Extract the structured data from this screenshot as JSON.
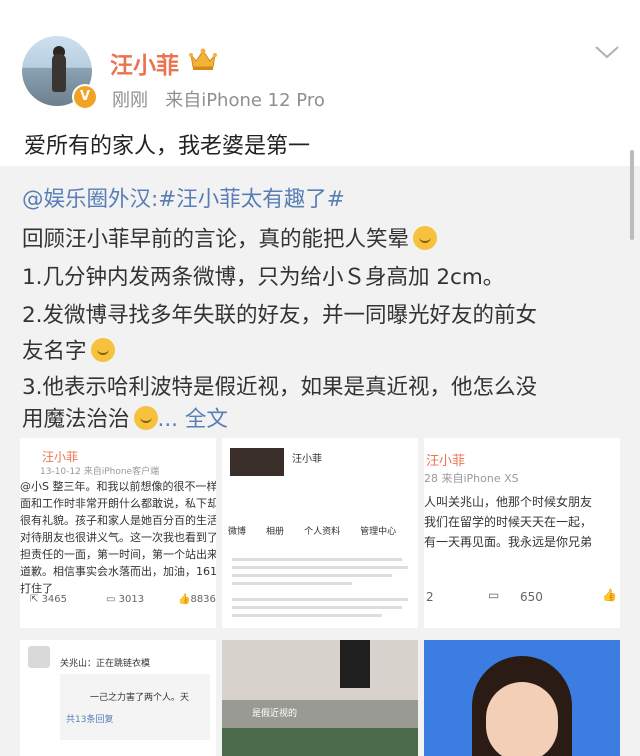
{
  "post": {
    "username": "汪小菲",
    "time": "刚刚",
    "source": "来自iPhone 12 Pro",
    "text": "爱所有的家人，我老婆是第一",
    "verified_badge": "V"
  },
  "repost": {
    "lines": [
      {
        "link": "@娱乐圈外汉:#汪小菲太有趣了#",
        "text": ""
      },
      {
        "link": "",
        "text": "回顾汪小菲早前的言论，真的能把人笑晕"
      },
      {
        "link": "",
        "text": "1.几分钟内发两条微博，只为给小Ｓ身高加 2cm。"
      },
      {
        "link": "",
        "text": "2.发微博寻找多年失联的好友，并一同曝光好友的前女"
      },
      {
        "link": "",
        "text": "友名字"
      },
      {
        "link": "",
        "text": "3.他表示哈利波特是假近视，如果是真近视，他怎么没"
      },
      {
        "link": "",
        "text": "用魔法治治"
      }
    ],
    "more": "... 全文",
    "images": {
      "img1": {
        "name": "汪小菲",
        "meta": "13-10-12 来自iPhone客户端",
        "body": [
          "@小S 整三年。和我以前想像的很不一样：",
          "面和工作时非常开朗什么都敢说，私下却",
          "很有礼貌。孩子和家人是她百分百的生活",
          "对待朋友也很讲义气。这一次我也看到了",
          "担责任的一面，第一时间，第一个站出来",
          "道歉。相信事实会水落而出，加油，161",
          "打住了"
        ],
        "reposts": "3465",
        "comments": "3013",
        "likes": "8836"
      },
      "img2": {
        "name": "汪小菲",
        "tabs": [
          "微博",
          "相册",
          "个人资料",
          "管理中心"
        ]
      },
      "img3": {
        "name": "汪小菲",
        "meta": "28 来自iPhone XS",
        "body": [
          "人叫关兆山，他那个时候女朋友",
          "我们在留学的时候天天在一起，",
          "有一天再见面。我永远是你兄弟"
        ],
        "reposts": "2",
        "likes_label": "650"
      },
      "img4": {
        "line1": "关兆山：正在跳链衣模",
        "line2": "一己之力害了两个人。天",
        "line3": "共13条回复"
      },
      "img5": {
        "caption": "是假近视的"
      }
    }
  },
  "colors": {
    "username": "#eb7350",
    "link": "#587eb5",
    "meta": "#8f8f8f",
    "repost_bg": "#f2f2f2"
  },
  "icons": [
    "crown-icon",
    "chevron-down-icon",
    "laugh-emoji-icon",
    "dog-emoji-icon",
    "share-icon",
    "comment-icon",
    "like-icon"
  ]
}
